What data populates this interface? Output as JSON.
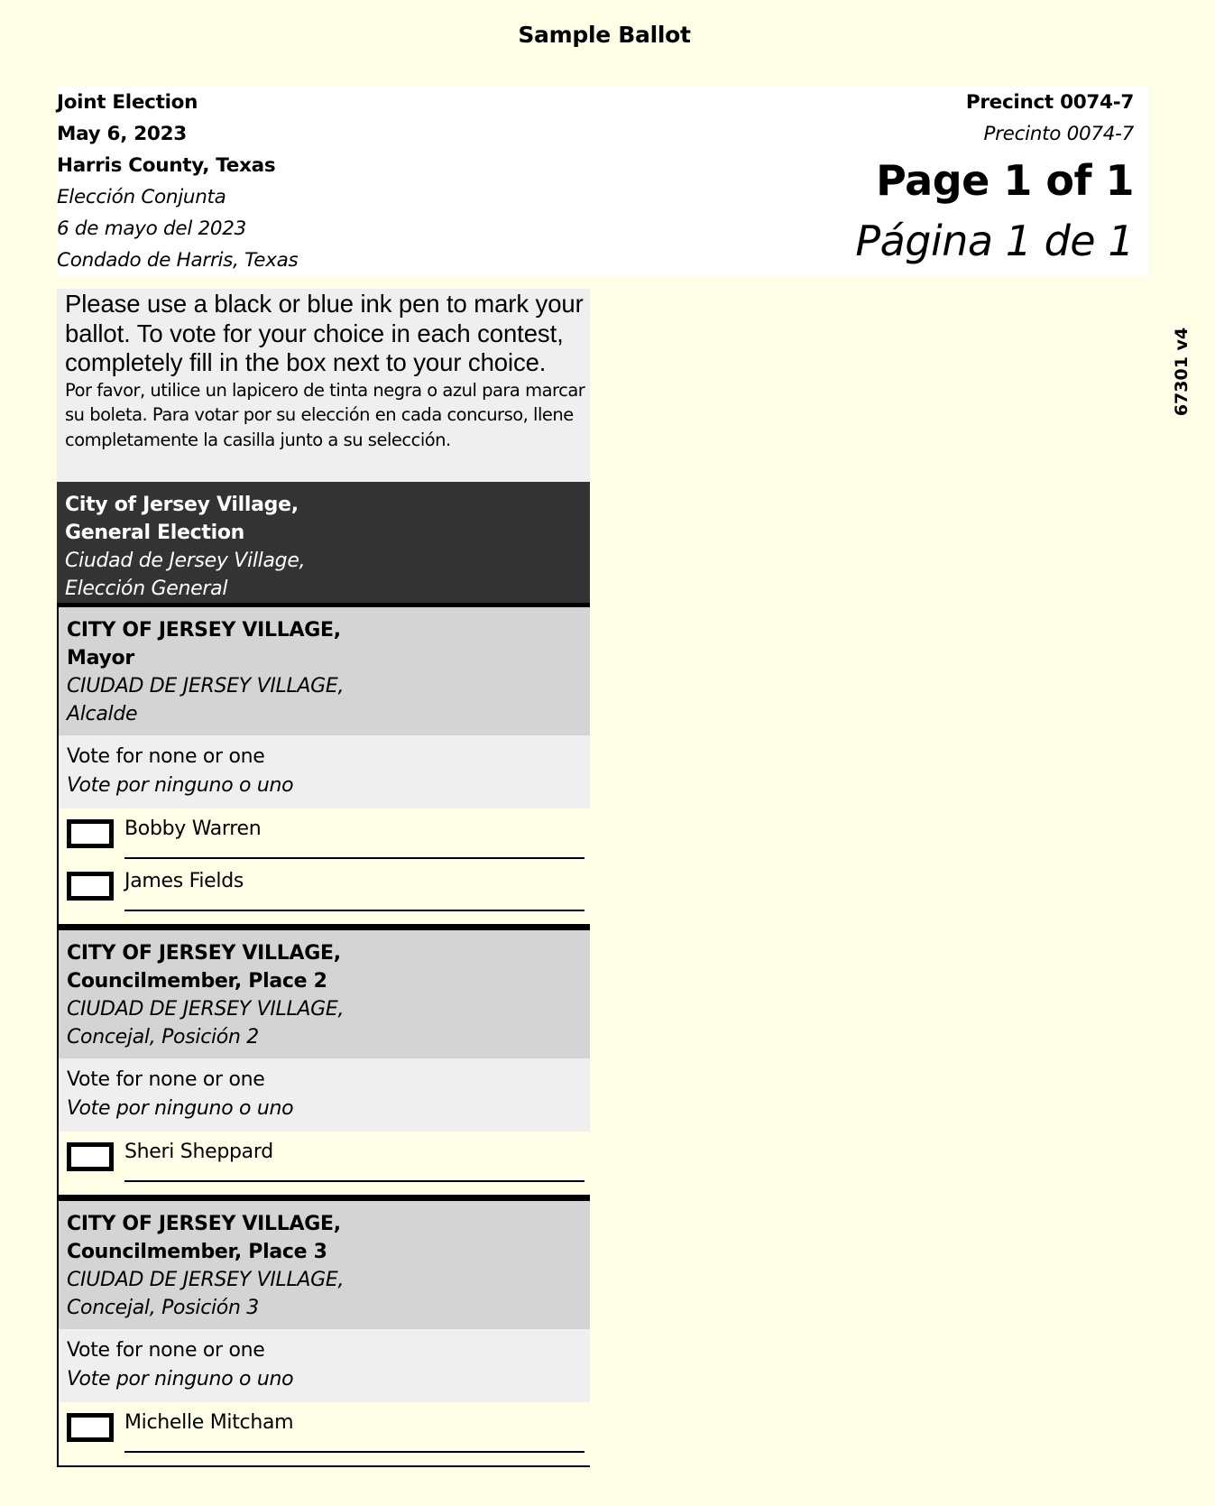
{
  "page": {
    "title": "Sample Ballot",
    "version": "67301 v4",
    "background_color": "#fffee6"
  },
  "header": {
    "left": {
      "english": [
        "Joint Election",
        "May 6, 2023",
        "Harris County, Texas"
      ],
      "spanish": [
        "Elección Conjunta",
        "6 de mayo del 2023",
        "Condado de Harris, Texas"
      ]
    },
    "right": {
      "precinct": "Precinct 0074-7",
      "precinto": "Precinto 0074-7",
      "page_of": "Page 1 of 1",
      "pagina": "Página 1 de 1"
    }
  },
  "instructions": {
    "english": "Please use a black or blue ink pen to mark your ballot.  To vote for your choice in each contest, completely fill in the box next to your choice.",
    "spanish": "Por favor, utilice un lapicero de tinta negra o azul para marcar su boleta. Para votar por su elección en cada concurso, llene completamente la casilla junto a su selección."
  },
  "election": {
    "english": [
      "City of Jersey Village,",
      "General Election"
    ],
    "spanish": [
      "Ciudad de Jersey Village,",
      "Elección General"
    ],
    "header_color": "#333333"
  },
  "contests": [
    {
      "english": [
        "CITY OF JERSEY VILLAGE,",
        "Mayor"
      ],
      "spanish": [
        "CIUDAD DE JERSEY VILLAGE,",
        "Alcalde"
      ],
      "vote_instr_en": "Vote for none or one",
      "vote_instr_es": "Vote por ninguno o uno",
      "candidates": [
        {
          "name": "Bobby Warren",
          "marked": false
        },
        {
          "name": "James Fields",
          "marked": false
        }
      ]
    },
    {
      "english": [
        "CITY OF JERSEY VILLAGE,",
        "Councilmember, Place 2"
      ],
      "spanish": [
        "CIUDAD DE JERSEY VILLAGE,",
        "Concejal, Posición 2"
      ],
      "vote_instr_en": "Vote for none or one",
      "vote_instr_es": "Vote por ninguno o uno",
      "candidates": [
        {
          "name": "Sheri Sheppard",
          "marked": false
        }
      ]
    },
    {
      "english": [
        "CITY OF JERSEY VILLAGE,",
        "Councilmember, Place 3"
      ],
      "spanish": [
        "CIUDAD DE JERSEY VILLAGE,",
        "Concejal, Posición 3"
      ],
      "vote_instr_en": "Vote for none or one",
      "vote_instr_es": "Vote por ninguno o uno",
      "candidates": [
        {
          "name": "Michelle Mitcham",
          "marked": false
        }
      ]
    }
  ]
}
